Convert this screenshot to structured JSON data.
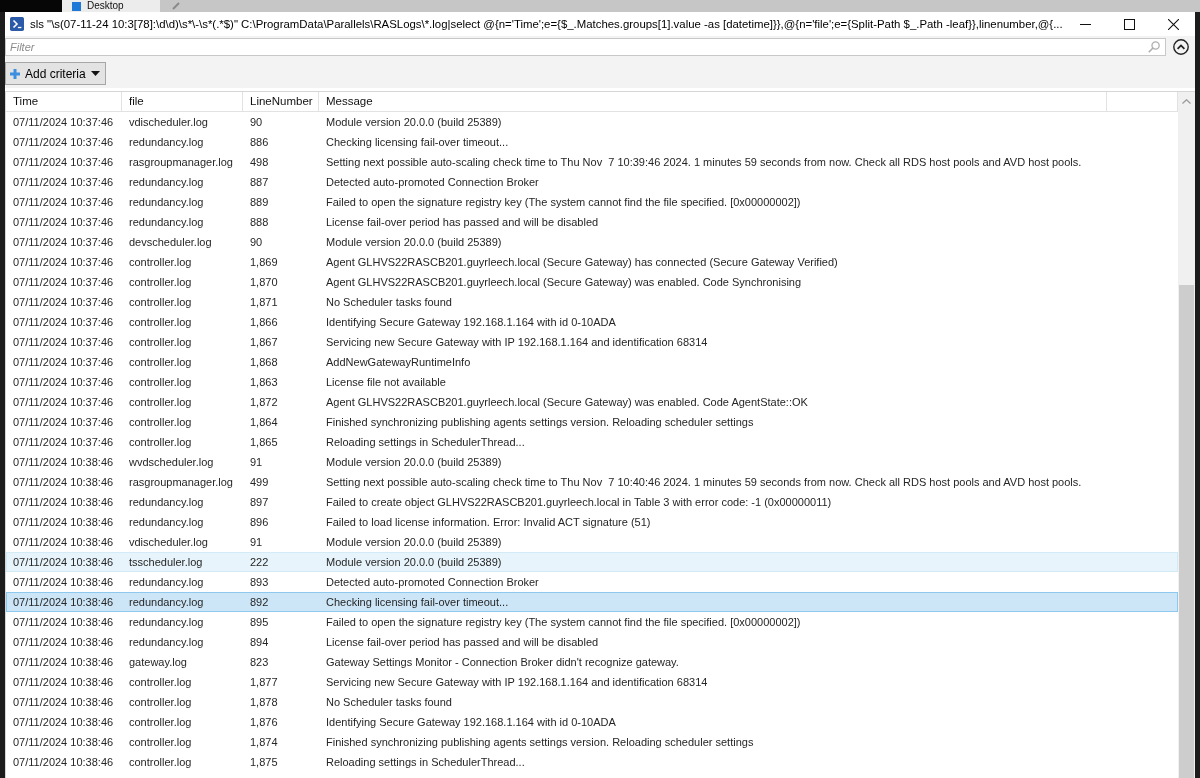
{
  "backdrop": {
    "tab_label": "Desktop"
  },
  "window": {
    "title": "sls \"\\s(07-11-24 10:3[78]:\\d\\d)\\s*\\-\\s*(.*$)\" C:\\ProgramData\\Parallels\\RASLogs\\*.log|select @{n='Time';e={$_.Matches.groups[1].value -as [datetime]}},@{n='file';e={Split-Path $_.Path -leaf}},linenumber,@{..."
  },
  "filter": {
    "placeholder": "Filter"
  },
  "add_criteria_button": {
    "label": "Add criteria"
  },
  "table": {
    "columns": [
      "Time",
      "file",
      "LineNumber",
      "Message"
    ],
    "rows": [
      {
        "time": "07/11/2024 10:37:46",
        "file": "vdischeduler.log",
        "line_number": "90",
        "message": "Module version 20.0.0 (build 25389)",
        "hovered": false,
        "selected": false
      },
      {
        "time": "07/11/2024 10:37:46",
        "file": "redundancy.log",
        "line_number": "886",
        "message": "Checking licensing fail-over timeout...",
        "hovered": false,
        "selected": false
      },
      {
        "time": "07/11/2024 10:37:46",
        "file": "rasgroupmanager.log",
        "line_number": "498",
        "message": "Setting next possible auto-scaling check time to Thu Nov  7 10:39:46 2024. 1 minutes 59 seconds from now. Check all RDS host pools and AVD host pools.",
        "hovered": false,
        "selected": false
      },
      {
        "time": "07/11/2024 10:37:46",
        "file": "redundancy.log",
        "line_number": "887",
        "message": "Detected auto-promoted Connection Broker",
        "hovered": false,
        "selected": false
      },
      {
        "time": "07/11/2024 10:37:46",
        "file": "redundancy.log",
        "line_number": "889",
        "message": "Failed to open the signature registry key (The system cannot find the file specified. [0x00000002])",
        "hovered": false,
        "selected": false
      },
      {
        "time": "07/11/2024 10:37:46",
        "file": "redundancy.log",
        "line_number": "888",
        "message": "License fail-over period has passed and will be disabled",
        "hovered": false,
        "selected": false
      },
      {
        "time": "07/11/2024 10:37:46",
        "file": "devscheduler.log",
        "line_number": "90",
        "message": "Module version 20.0.0 (build 25389)",
        "hovered": false,
        "selected": false
      },
      {
        "time": "07/11/2024 10:37:46",
        "file": "controller.log",
        "line_number": "1,869",
        "message": "Agent GLHVS22RASCB201.guyrleech.local (Secure Gateway) has connected (Secure Gateway Verified)",
        "hovered": false,
        "selected": false
      },
      {
        "time": "07/11/2024 10:37:46",
        "file": "controller.log",
        "line_number": "1,870",
        "message": "Agent GLHVS22RASCB201.guyrleech.local (Secure Gateway) was enabled. Code Synchronising",
        "hovered": false,
        "selected": false
      },
      {
        "time": "07/11/2024 10:37:46",
        "file": "controller.log",
        "line_number": "1,871",
        "message": "No Scheduler tasks found",
        "hovered": false,
        "selected": false
      },
      {
        "time": "07/11/2024 10:37:46",
        "file": "controller.log",
        "line_number": "1,866",
        "message": "Identifying Secure Gateway 192.168.1.164 with id 0-10ADA",
        "hovered": false,
        "selected": false
      },
      {
        "time": "07/11/2024 10:37:46",
        "file": "controller.log",
        "line_number": "1,867",
        "message": "Servicing new Secure Gateway with IP 192.168.1.164 and identification 68314",
        "hovered": false,
        "selected": false
      },
      {
        "time": "07/11/2024 10:37:46",
        "file": "controller.log",
        "line_number": "1,868",
        "message": "AddNewGatewayRuntimeInfo",
        "hovered": false,
        "selected": false
      },
      {
        "time": "07/11/2024 10:37:46",
        "file": "controller.log",
        "line_number": "1,863",
        "message": "License file not available",
        "hovered": false,
        "selected": false
      },
      {
        "time": "07/11/2024 10:37:46",
        "file": "controller.log",
        "line_number": "1,872",
        "message": "Agent GLHVS22RASCB201.guyrleech.local (Secure Gateway) was enabled. Code AgentState::OK",
        "hovered": false,
        "selected": false
      },
      {
        "time": "07/11/2024 10:37:46",
        "file": "controller.log",
        "line_number": "1,864",
        "message": "Finished synchronizing publishing agents settings version. Reloading scheduler settings",
        "hovered": false,
        "selected": false
      },
      {
        "time": "07/11/2024 10:37:46",
        "file": "controller.log",
        "line_number": "1,865",
        "message": "Reloading settings in SchedulerThread...",
        "hovered": false,
        "selected": false
      },
      {
        "time": "07/11/2024 10:38:46",
        "file": "wvdscheduler.log",
        "line_number": "91",
        "message": "Module version 20.0.0 (build 25389)",
        "hovered": false,
        "selected": false
      },
      {
        "time": "07/11/2024 10:38:46",
        "file": "rasgroupmanager.log",
        "line_number": "499",
        "message": "Setting next possible auto-scaling check time to Thu Nov  7 10:40:46 2024. 1 minutes 59 seconds from now. Check all RDS host pools and AVD host pools.",
        "hovered": false,
        "selected": false
      },
      {
        "time": "07/11/2024 10:38:46",
        "file": "redundancy.log",
        "line_number": "897",
        "message": "Failed to create object GLHVS22RASCB201.guyrleech.local in Table 3 with error code: -1 (0x00000011)",
        "hovered": false,
        "selected": false
      },
      {
        "time": "07/11/2024 10:38:46",
        "file": "redundancy.log",
        "line_number": "896",
        "message": "Failed to load license information. Error: Invalid ACT signature (51)",
        "hovered": false,
        "selected": false
      },
      {
        "time": "07/11/2024 10:38:46",
        "file": "vdischeduler.log",
        "line_number": "91",
        "message": "Module version 20.0.0 (build 25389)",
        "hovered": false,
        "selected": false
      },
      {
        "time": "07/11/2024 10:38:46",
        "file": "tsscheduler.log",
        "line_number": "222",
        "message": "Module version 20.0.0 (build 25389)",
        "hovered": true,
        "selected": false
      },
      {
        "time": "07/11/2024 10:38:46",
        "file": "redundancy.log",
        "line_number": "893",
        "message": "Detected auto-promoted Connection Broker",
        "hovered": false,
        "selected": false
      },
      {
        "time": "07/11/2024 10:38:46",
        "file": "redundancy.log",
        "line_number": "892",
        "message": "Checking licensing fail-over timeout...",
        "hovered": false,
        "selected": true
      },
      {
        "time": "07/11/2024 10:38:46",
        "file": "redundancy.log",
        "line_number": "895",
        "message": "Failed to open the signature registry key (The system cannot find the file specified. [0x00000002])",
        "hovered": false,
        "selected": false
      },
      {
        "time": "07/11/2024 10:38:46",
        "file": "redundancy.log",
        "line_number": "894",
        "message": "License fail-over period has passed and will be disabled",
        "hovered": false,
        "selected": false
      },
      {
        "time": "07/11/2024 10:38:46",
        "file": "gateway.log",
        "line_number": "823",
        "message": "Gateway Settings Monitor - Connection Broker didn't recognize gateway.",
        "hovered": false,
        "selected": false
      },
      {
        "time": "07/11/2024 10:38:46",
        "file": "controller.log",
        "line_number": "1,877",
        "message": "Servicing new Secure Gateway with IP 192.168.1.164 and identification 68314",
        "hovered": false,
        "selected": false
      },
      {
        "time": "07/11/2024 10:38:46",
        "file": "controller.log",
        "line_number": "1,878",
        "message": "No Scheduler tasks found",
        "hovered": false,
        "selected": false
      },
      {
        "time": "07/11/2024 10:38:46",
        "file": "controller.log",
        "line_number": "1,876",
        "message": "Identifying Secure Gateway 192.168.1.164 with id 0-10ADA",
        "hovered": false,
        "selected": false
      },
      {
        "time": "07/11/2024 10:38:46",
        "file": "controller.log",
        "line_number": "1,874",
        "message": "Finished synchronizing publishing agents settings version. Reloading scheduler settings",
        "hovered": false,
        "selected": false
      },
      {
        "time": "07/11/2024 10:38:46",
        "file": "controller.log",
        "line_number": "1,875",
        "message": "Reloading settings in SchedulerThread...",
        "hovered": false,
        "selected": false
      }
    ]
  }
}
